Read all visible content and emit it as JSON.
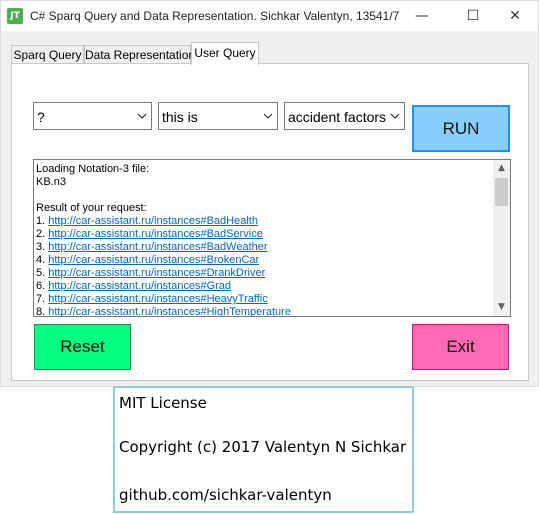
{
  "window": {
    "title": "C# Sparq Query and Data Representation. Sichkar Valentyn, 13541/7",
    "icon_label": "JT",
    "minimize_glyph": "—",
    "maximize_glyph": "☐",
    "close_glyph": "✕"
  },
  "tabs": [
    {
      "label": "Sparq Query"
    },
    {
      "label": "Data Representation"
    },
    {
      "label": "User Query",
      "active": true
    }
  ],
  "query": {
    "subject": "?",
    "predicate": "this is",
    "object": "accident factors",
    "run_label": "RUN"
  },
  "output": {
    "lines": [
      "Loading Notation-3 file:",
      "KB.n3",
      "",
      "Result of your request:"
    ],
    "results": [
      {
        "num": "1. ",
        "link": "http://car-assistant.ru/instances#BadHealth"
      },
      {
        "num": "2. ",
        "link": "http://car-assistant.ru/instances#BadService"
      },
      {
        "num": "3. ",
        "link": "http://car-assistant.ru/instances#BadWeather"
      },
      {
        "num": "4. ",
        "link": "http://car-assistant.ru/instances#BrokenCar"
      },
      {
        "num": "5. ",
        "link": "http://car-assistant.ru/instances#DrankDriver"
      },
      {
        "num": "6. ",
        "link": "http://car-assistant.ru/instances#Grad"
      },
      {
        "num": "7. ",
        "link": "http://car-assistant.ru/instances#HeavyTraffic"
      },
      {
        "num": "8. ",
        "link": "http://car-assistant.ru/instances#HighTemperature"
      }
    ]
  },
  "buttons": {
    "reset_label": "Reset",
    "exit_label": "Exit"
  },
  "license": {
    "line1": "MIT License",
    "line2": "Copyright (c) 2017 Valentyn N Sichkar",
    "line3": "github.com/sichkar-valentyn"
  },
  "colors": {
    "run_bg": "#87cefa",
    "reset_bg": "#00ff7f",
    "exit_bg": "#ff69b4",
    "link": "#0066cc",
    "license_border": "#87ceeb"
  }
}
